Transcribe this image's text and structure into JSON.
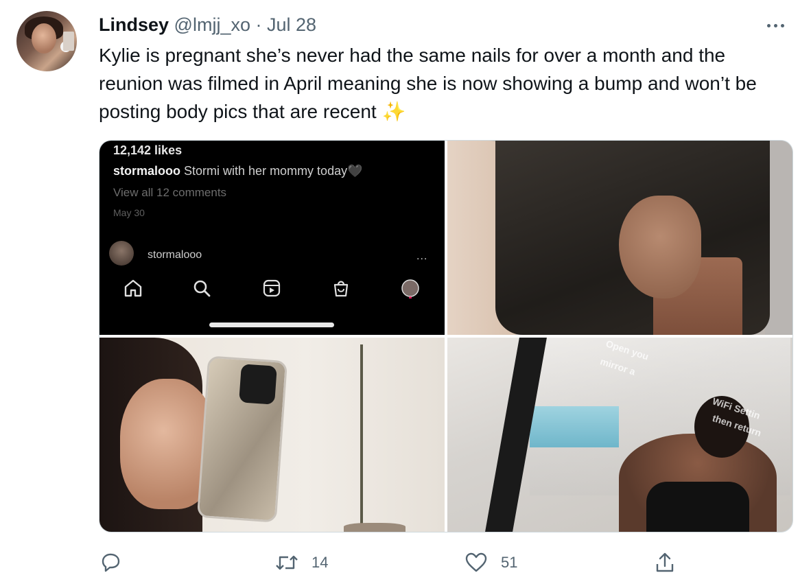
{
  "tweet": {
    "display_name": "Lindsey",
    "handle": "@lmjj_xo",
    "separator": "·",
    "date": "Jul 28",
    "text": "Kylie is pregnant she’s never had the same nails for over a month and the reunion was filmed in April meaning she is now showing a bump and won’t be posting body pics that are recent ✨"
  },
  "media": {
    "instagram_screenshot": {
      "likes": "12,142 likes",
      "caption_user": "stormalooo",
      "caption_text": "Stormi with her mommy today",
      "caption_emoji": "🖤",
      "view_comments": "View all 12 comments",
      "post_date": "May 30",
      "story_user": "stormalooo",
      "more": "..."
    },
    "mirror_overlay": {
      "line1": "Open you",
      "line2": "mirror a",
      "line3": "WiFi Settin",
      "line4": "then return"
    }
  },
  "actions": {
    "reply_count": "",
    "retweet_count": "14",
    "like_count": "51"
  },
  "colors": {
    "text": "#0f1419",
    "secondary": "#536471",
    "border": "#cfd9de"
  },
  "icons": [
    "more-icon",
    "home-icon",
    "search-icon",
    "reels-icon",
    "shop-icon",
    "reply-icon",
    "retweet-icon",
    "like-icon",
    "share-icon"
  ]
}
